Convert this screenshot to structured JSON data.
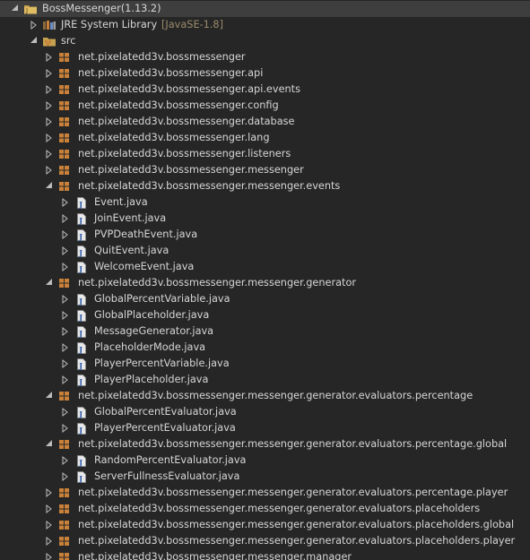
{
  "colors": {
    "background": "#262626",
    "selected_row": "#3e3e3e",
    "text": "#d6d6d6",
    "decoration": "#9a8a6a",
    "twisty": "#bdbdbd",
    "package_icon": "#c9813a",
    "java_file_icon": "#e8e8e8"
  },
  "tree": [
    {
      "label": "BossMessenger(1.13.2)",
      "decoration": "",
      "depth": 0,
      "expanded": true,
      "icon": "project-icon",
      "selected": true
    },
    {
      "label": "JRE System Library",
      "decoration": "[JavaSE-1.8]",
      "depth": 1,
      "expanded": false,
      "icon": "library-icon"
    },
    {
      "label": "src",
      "decoration": "",
      "depth": 1,
      "expanded": true,
      "icon": "source-folder-icon"
    },
    {
      "label": "net.pixelatedd3v.bossmessenger",
      "depth": 2,
      "expanded": false,
      "icon": "package-icon"
    },
    {
      "label": "net.pixelatedd3v.bossmessenger.api",
      "depth": 2,
      "expanded": false,
      "icon": "package-icon"
    },
    {
      "label": "net.pixelatedd3v.bossmessenger.api.events",
      "depth": 2,
      "expanded": false,
      "icon": "package-icon"
    },
    {
      "label": "net.pixelatedd3v.bossmessenger.config",
      "depth": 2,
      "expanded": false,
      "icon": "package-icon"
    },
    {
      "label": "net.pixelatedd3v.bossmessenger.database",
      "depth": 2,
      "expanded": false,
      "icon": "package-icon"
    },
    {
      "label": "net.pixelatedd3v.bossmessenger.lang",
      "depth": 2,
      "expanded": false,
      "icon": "package-icon"
    },
    {
      "label": "net.pixelatedd3v.bossmessenger.listeners",
      "depth": 2,
      "expanded": false,
      "icon": "package-icon"
    },
    {
      "label": "net.pixelatedd3v.bossmessenger.messenger",
      "depth": 2,
      "expanded": false,
      "icon": "package-icon"
    },
    {
      "label": "net.pixelatedd3v.bossmessenger.messenger.events",
      "depth": 2,
      "expanded": true,
      "icon": "package-icon"
    },
    {
      "label": "Event.java",
      "depth": 3,
      "expanded": false,
      "icon": "java-file-icon"
    },
    {
      "label": "JoinEvent.java",
      "depth": 3,
      "expanded": false,
      "icon": "java-file-icon"
    },
    {
      "label": "PVPDeathEvent.java",
      "depth": 3,
      "expanded": false,
      "icon": "java-file-icon"
    },
    {
      "label": "QuitEvent.java",
      "depth": 3,
      "expanded": false,
      "icon": "java-file-icon"
    },
    {
      "label": "WelcomeEvent.java",
      "depth": 3,
      "expanded": false,
      "icon": "java-file-icon"
    },
    {
      "label": "net.pixelatedd3v.bossmessenger.messenger.generator",
      "depth": 2,
      "expanded": true,
      "icon": "package-icon"
    },
    {
      "label": "GlobalPercentVariable.java",
      "depth": 3,
      "expanded": false,
      "icon": "java-file-icon"
    },
    {
      "label": "GlobalPlaceholder.java",
      "depth": 3,
      "expanded": false,
      "icon": "java-file-icon"
    },
    {
      "label": "MessageGenerator.java",
      "depth": 3,
      "expanded": false,
      "icon": "java-file-icon"
    },
    {
      "label": "PlaceholderMode.java",
      "depth": 3,
      "expanded": false,
      "icon": "java-file-icon"
    },
    {
      "label": "PlayerPercentVariable.java",
      "depth": 3,
      "expanded": false,
      "icon": "java-file-icon"
    },
    {
      "label": "PlayerPlaceholder.java",
      "depth": 3,
      "expanded": false,
      "icon": "java-file-icon"
    },
    {
      "label": "net.pixelatedd3v.bossmessenger.messenger.generator.evaluators.percentage",
      "depth": 2,
      "expanded": true,
      "icon": "package-icon"
    },
    {
      "label": "GlobalPercentEvaluator.java",
      "depth": 3,
      "expanded": false,
      "icon": "java-file-icon"
    },
    {
      "label": "PlayerPercentEvaluator.java",
      "depth": 3,
      "expanded": false,
      "icon": "java-file-icon"
    },
    {
      "label": "net.pixelatedd3v.bossmessenger.messenger.generator.evaluators.percentage.global",
      "depth": 2,
      "expanded": true,
      "icon": "package-icon"
    },
    {
      "label": "RandomPercentEvaluator.java",
      "depth": 3,
      "expanded": false,
      "icon": "java-file-icon"
    },
    {
      "label": "ServerFullnessEvaluator.java",
      "depth": 3,
      "expanded": false,
      "icon": "java-file-icon"
    },
    {
      "label": "net.pixelatedd3v.bossmessenger.messenger.generator.evaluators.percentage.player",
      "depth": 2,
      "expanded": false,
      "icon": "package-icon"
    },
    {
      "label": "net.pixelatedd3v.bossmessenger.messenger.generator.evaluators.placeholders",
      "depth": 2,
      "expanded": false,
      "icon": "package-icon"
    },
    {
      "label": "net.pixelatedd3v.bossmessenger.messenger.generator.evaluators.placeholders.global",
      "depth": 2,
      "expanded": false,
      "icon": "package-icon"
    },
    {
      "label": "net.pixelatedd3v.bossmessenger.messenger.generator.evaluators.placeholders.player",
      "depth": 2,
      "expanded": false,
      "icon": "package-icon"
    },
    {
      "label": "net.pixelatedd3v.bossmessenger.messenger.manager",
      "depth": 2,
      "expanded": false,
      "icon": "package-icon"
    }
  ]
}
